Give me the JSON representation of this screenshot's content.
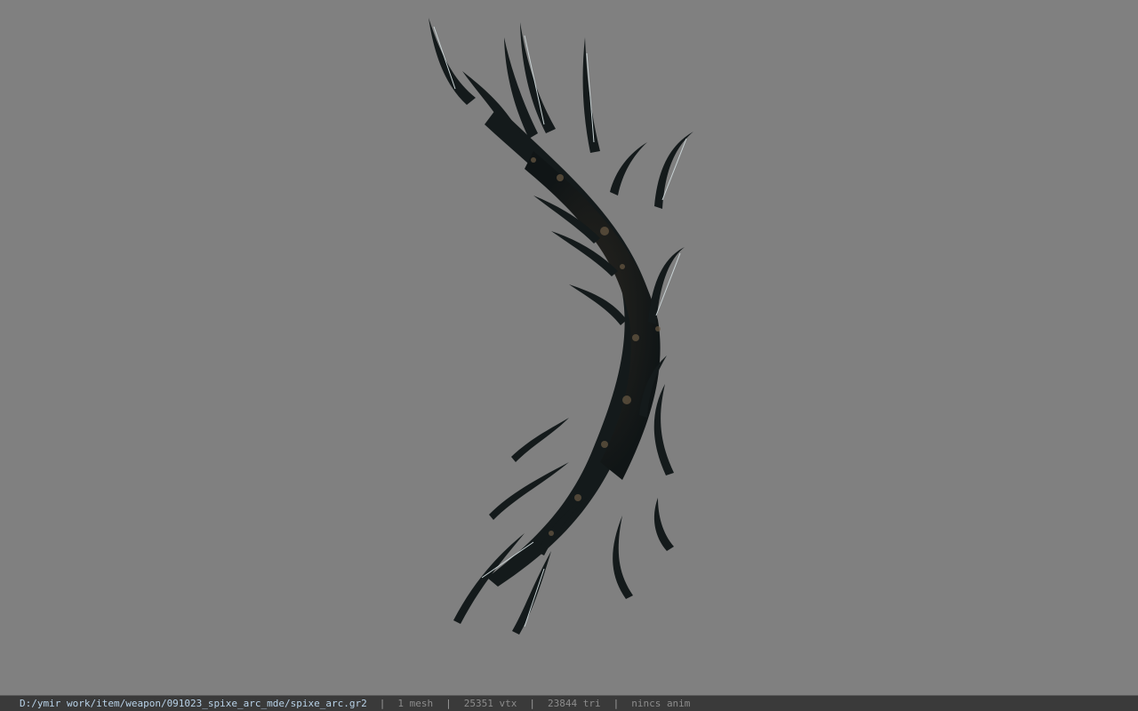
{
  "viewport": {
    "background_color": "#808080",
    "model_name": "spixe_arc",
    "model_colors": {
      "body": "#141a1b",
      "highlight": "#c8d2d4",
      "detail": "#6a5a44"
    }
  },
  "status_bar": {
    "file_path": "D:/ymir work/item/weapon/091023_spixe_arc_mde/spixe_arc.gr2",
    "separator": "|",
    "mesh_count": "1 mesh",
    "vertex_count": "25351 vtx",
    "triangle_count": "23844 tri",
    "anim_status": "nincs anim",
    "path_color": "#b8d2e8",
    "text_color": "#8c8c8c"
  }
}
